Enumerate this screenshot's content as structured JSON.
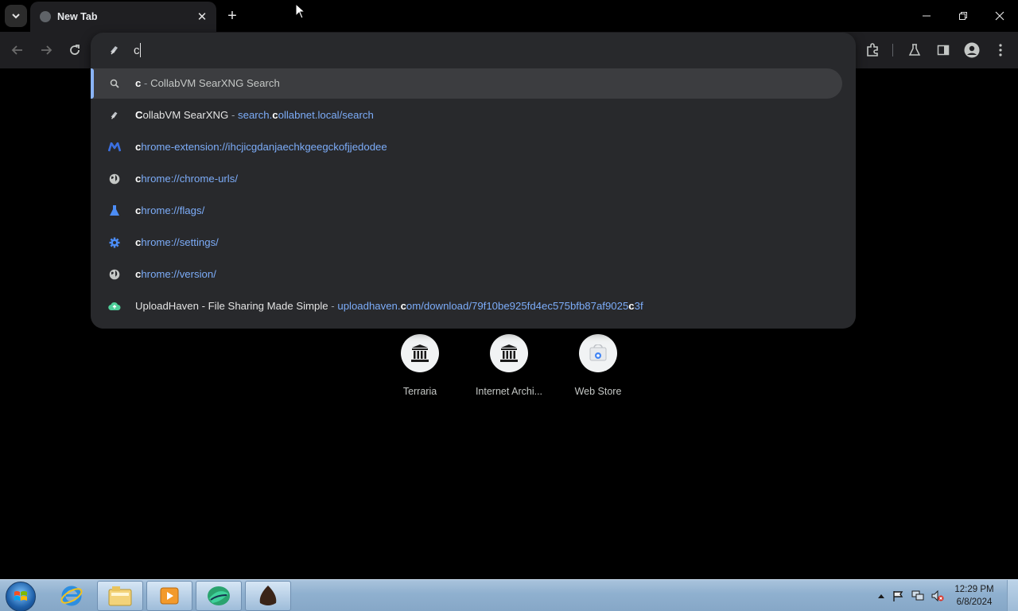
{
  "browser": {
    "tab": {
      "title": "New Tab",
      "close_glyph": "✕"
    },
    "newtab_glyph": "+",
    "window_controls": {
      "minimize": "minimize-icon",
      "restore": "restore-icon",
      "close": "close-icon"
    }
  },
  "omnibox": {
    "input_value": "c",
    "suggestions": [
      {
        "icon": "search-icon",
        "match": "c",
        "sep": " - ",
        "rest": "CollabVM SearXNG Search",
        "type": "search"
      },
      {
        "icon": "searxng-icon",
        "title_match": "C",
        "title_rest": "ollabVM SearXNG",
        "sep": " - ",
        "url_pre": "search.",
        "url_match": "c",
        "url_post": "ollabnet.local/search"
      },
      {
        "icon": "extension-m-icon",
        "url_match": "c",
        "url_post": "hrome-extension://ihcjicgdanjaechkgeegckofjjedodee"
      },
      {
        "icon": "globe-icon",
        "url_match": "c",
        "url_post": "hrome://chrome-urls/"
      },
      {
        "icon": "flask-icon",
        "url_match": "c",
        "url_post": "hrome://flags/"
      },
      {
        "icon": "gear-icon",
        "url_match": "c",
        "url_post": "hrome://settings/"
      },
      {
        "icon": "globe-icon",
        "url_match": "c",
        "url_post": "hrome://version/"
      },
      {
        "icon": "uploadhaven-icon",
        "title": "UploadHaven - File Sharing Made Simple",
        "sep": " - ",
        "url_pre": "uploadhaven.",
        "url_match": "c",
        "url_mid": "om/download/79f10be925fd4ec575bfb87af9025",
        "url_match2": "c",
        "url_post": "3f"
      }
    ]
  },
  "shortcuts": [
    {
      "label": "Terraria",
      "icon": "archive-building-icon"
    },
    {
      "label": "Internet Archi...",
      "icon": "archive-building-icon"
    },
    {
      "label": "Web Store",
      "icon": "webstore-icon"
    }
  ],
  "taskbar": {
    "clock_time": "12:29 PM",
    "clock_date": "6/8/2024"
  }
}
